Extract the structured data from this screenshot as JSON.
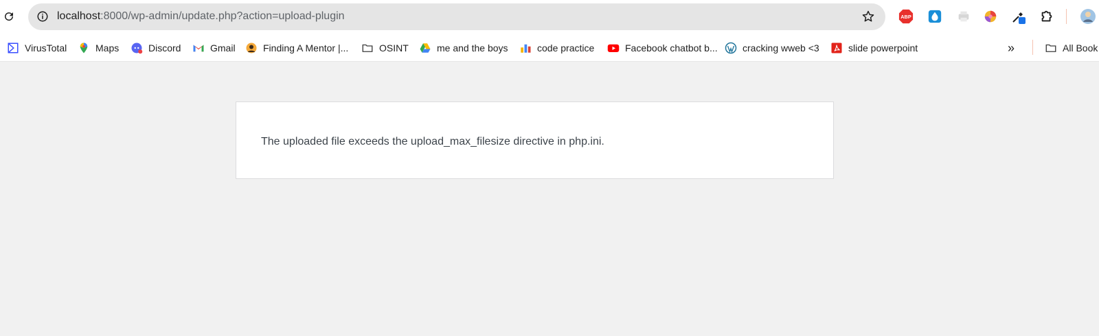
{
  "browser": {
    "url_host": "localhost",
    "url_path": ":8000/wp-admin/update.php?action=upload-plugin",
    "icons": {
      "reload": "reload-icon",
      "site_info": "info-icon",
      "bookmark_star": "star-icon"
    },
    "extensions": [
      {
        "name": "adblock-plus-icon",
        "label": "ABP",
        "color": "#e8302c"
      },
      {
        "name": "water-drop-extension-icon",
        "color": "#1a8fd8"
      },
      {
        "name": "printer-extension-icon",
        "color": "#cfcfcf"
      },
      {
        "name": "colorful-circle-extension-icon",
        "color": "#f2b42b"
      },
      {
        "name": "eyedropper-extension-icon",
        "color": "#1a73e8"
      },
      {
        "name": "puzzle-extensions-icon",
        "color": "#1f1f1f"
      },
      {
        "name": "profile-avatar-icon",
        "color": "#a0c4e4"
      }
    ]
  },
  "bookmarks": {
    "items": [
      {
        "label": "VirusTotal",
        "icon": "virustotal-icon"
      },
      {
        "label": "Maps",
        "icon": "maps-pin-icon"
      },
      {
        "label": "Discord",
        "icon": "discord-icon"
      },
      {
        "label": "Gmail",
        "icon": "gmail-icon"
      },
      {
        "label": "Finding A Mentor |...",
        "icon": "mentor-avatar-icon"
      },
      {
        "label": "OSINT",
        "icon": "folder-icon"
      },
      {
        "label": "me and the boys",
        "icon": "google-drive-icon"
      },
      {
        "label": "code practice",
        "icon": "bar-chart-icon"
      },
      {
        "label": "Facebook chatbot b...",
        "icon": "youtube-icon"
      },
      {
        "label": "cracking wweb <3",
        "icon": "wordpress-icon"
      },
      {
        "label": "slide powerpoint",
        "icon": "acrobat-icon"
      }
    ],
    "overflow": "»",
    "all_bookmarks": "All Book"
  },
  "page": {
    "error_message": "The uploaded file exceeds the upload_max_filesize directive in php.ini."
  }
}
